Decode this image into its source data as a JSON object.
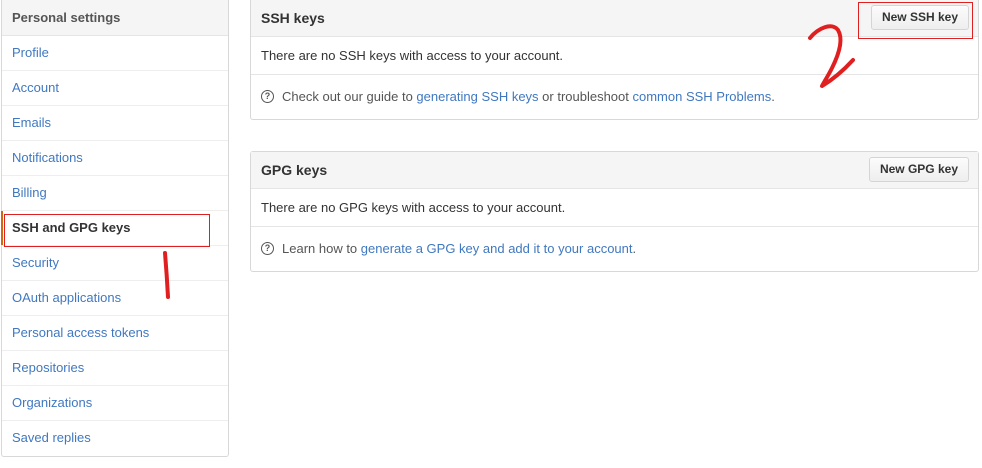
{
  "sidebar": {
    "header": "Personal settings",
    "items": [
      {
        "label": "Profile"
      },
      {
        "label": "Account"
      },
      {
        "label": "Emails"
      },
      {
        "label": "Notifications"
      },
      {
        "label": "Billing"
      },
      {
        "label": "SSH and GPG keys",
        "selected": true
      },
      {
        "label": "Security"
      },
      {
        "label": "OAuth applications"
      },
      {
        "label": "Personal access tokens"
      },
      {
        "label": "Repositories"
      },
      {
        "label": "Organizations"
      },
      {
        "label": "Saved replies"
      }
    ]
  },
  "ssh": {
    "title": "SSH keys",
    "button_label": "New SSH key",
    "empty_text": "There are no SSH keys with access to your account.",
    "help_prefix": "Check out our guide to ",
    "help_link1": "generating SSH keys",
    "help_middle": " or troubleshoot ",
    "help_link2": "common SSH Problems",
    "help_suffix": "."
  },
  "gpg": {
    "title": "GPG keys",
    "button_label": "New GPG key",
    "empty_text": "There are no GPG keys with access to your account.",
    "help_prefix": "Learn how to ",
    "help_link": "generate a GPG key and add it to your account",
    "help_suffix": "."
  },
  "colors": {
    "link": "#4078c0",
    "selected_accent": "#d26911",
    "annotation": "#e02020"
  },
  "icons": {
    "help": "question-circle-icon"
  }
}
